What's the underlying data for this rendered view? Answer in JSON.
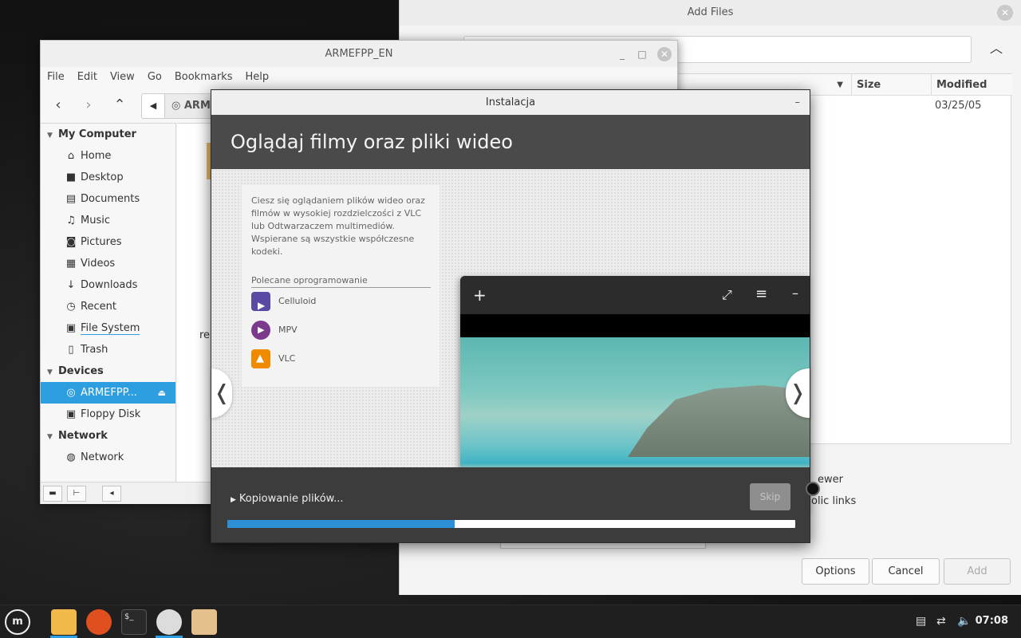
{
  "add_files": {
    "title": "Add Files",
    "columns": [
      "Size",
      "Modified"
    ],
    "modified_value": "03/25/05",
    "option_fragments": [
      "ewer",
      "olic links"
    ],
    "buttons": {
      "options": "Options",
      "cancel": "Cancel",
      "add": "Add"
    }
  },
  "file_manager": {
    "title": "ARMEFPP_EN",
    "menu": [
      "File",
      "Edit",
      "View",
      "Go",
      "Bookmarks",
      "Help"
    ],
    "path_segment": "ARM",
    "content_fragment": "re",
    "sections": {
      "my_computer": "My Computer",
      "devices": "Devices",
      "network": "Network"
    },
    "places": [
      {
        "label": "Home",
        "icon": "home-icon"
      },
      {
        "label": "Desktop",
        "icon": "desktop-icon"
      },
      {
        "label": "Documents",
        "icon": "documents-icon"
      },
      {
        "label": "Music",
        "icon": "music-icon"
      },
      {
        "label": "Pictures",
        "icon": "pictures-icon"
      },
      {
        "label": "Videos",
        "icon": "videos-icon"
      },
      {
        "label": "Downloads",
        "icon": "downloads-icon"
      },
      {
        "label": "Recent",
        "icon": "recent-icon"
      },
      {
        "label": "File System",
        "icon": "filesystem-icon"
      },
      {
        "label": "Trash",
        "icon": "trash-icon"
      }
    ],
    "devices": [
      {
        "label": "ARMEFPP...",
        "icon": "disc-icon",
        "active": true
      },
      {
        "label": "Floppy Disk",
        "icon": "floppy-icon"
      }
    ],
    "network": [
      {
        "label": "Network",
        "icon": "network-icon"
      }
    ]
  },
  "installer": {
    "title": "Instalacja",
    "heading": "Oglądaj filmy oraz pliki wideo",
    "description": "Ciesz się oglądaniem plików wideo oraz filmów w wysokiej rozdzielczości z VLC lub Odtwarzaczem multimediów. Wspierane są wszystkie współczesne kodeki.",
    "recommended_label": "Polecane oprogramowanie",
    "apps": [
      {
        "name": "Celluloid",
        "color": "#5b4aa3"
      },
      {
        "name": "MPV",
        "color": "#7b3a8c"
      },
      {
        "name": "VLC",
        "color": "#f08a00"
      }
    ],
    "status_text": "Kopiowanie plików...",
    "skip_label": "Skip",
    "progress": 0.4
  },
  "taskbar": {
    "clock": "07:08",
    "apps": [
      "menu-icon",
      "files-icon",
      "firefox-icon",
      "terminal-icon",
      "disc-icon",
      "archive-icon"
    ]
  },
  "colors": {
    "accent": "#2d9ee0",
    "progress": "#2d8fd5"
  }
}
